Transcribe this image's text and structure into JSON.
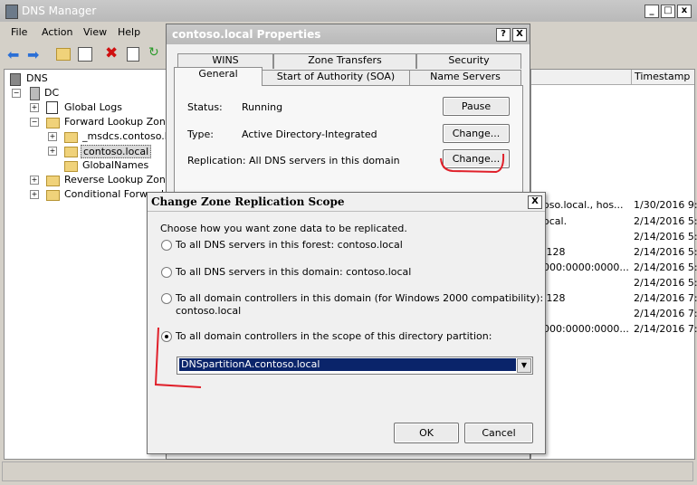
{
  "dns_manager": {
    "title": "DNS Manager",
    "menu": [
      "File",
      "Action",
      "View",
      "Help"
    ],
    "tree": {
      "root": "DNS",
      "server": "DC",
      "global_logs": "Global Logs",
      "forward": "Forward Lookup Zones",
      "msdcs": "_msdcs.contoso.local",
      "contoso": "contoso.local",
      "globalnames": "GlobalNames",
      "reverse": "Reverse Lookup Zones",
      "conditional": "Conditional Forwarders"
    },
    "column_timestamp": "Timestamp",
    "right_rows": [
      {
        "mid": "oso.local., hos...",
        "ts": "1/30/2016 9:"
      },
      {
        "mid": "ocal.",
        "ts": "2/14/2016 5:"
      },
      {
        "mid": "",
        "ts": "2/14/2016 5:"
      },
      {
        "mid": ".128",
        "ts": "2/14/2016 5:"
      },
      {
        "mid": "000:0000:0000...",
        "ts": "2/14/2016 5:"
      },
      {
        "mid": "",
        "ts": "2/14/2016 5:"
      },
      {
        "mid": ".128",
        "ts": "2/14/2016 7:"
      },
      {
        "mid": "",
        "ts": "2/14/2016 7:"
      },
      {
        "mid": "000:0000:0000...",
        "ts": "2/14/2016 7:"
      }
    ]
  },
  "properties": {
    "title": "contoso.local Properties",
    "help_btn": "?",
    "close_btn": "X",
    "tabs_row1": [
      "WINS",
      "Zone Transfers",
      "Security"
    ],
    "tabs_row2": [
      "General",
      "Start of Authority (SOA)",
      "Name Servers"
    ],
    "status_label": "Status:",
    "status_value": "Running",
    "type_label": "Type:",
    "type_value": "Active Directory-Integrated",
    "replication_label": "Replication:",
    "replication_value": "All DNS servers in this domain",
    "pause": "Pause",
    "change1": "Change...",
    "change2": "Change..."
  },
  "scope_dialog": {
    "title": "Change Zone Replication Scope",
    "close_btn": "X",
    "prompt": "Choose how you want zone data to be replicated.",
    "opt1": "To all DNS servers in this forest: contoso.local",
    "opt2": "To all DNS servers in this domain: contoso.local",
    "opt3_line1": "To all domain controllers in this domain (for Windows 2000 compatibility):",
    "opt3_line2": "contoso.local",
    "opt4": "To all domain controllers in the scope of this directory partition:",
    "partition_value": "DNSpartitionA.contoso.local",
    "ok": "OK",
    "cancel": "Cancel"
  },
  "annotation_color": "#e0202a"
}
